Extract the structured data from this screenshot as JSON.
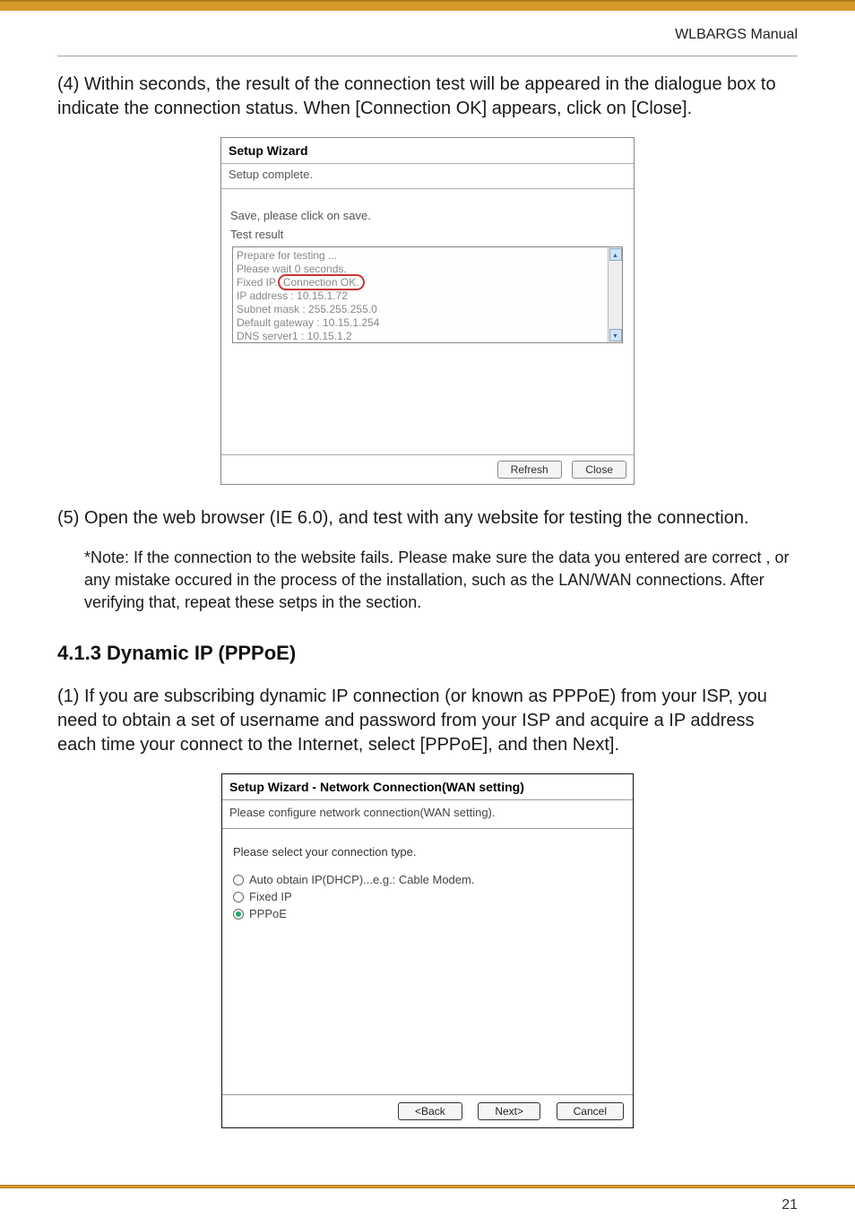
{
  "header": {
    "manual_title": "WLBARGS Manual"
  },
  "step4": {
    "num": "(4)",
    "text": "Within seconds, the result of the connection test will be appeared in the dialogue box to indicate the connection status. When [Connection OK] appears, click on [Close]."
  },
  "shot1": {
    "title": "Setup Wizard",
    "subtitle": "Setup complete.",
    "save_line": "Save, please click on save.",
    "test_label": "Test result",
    "lines": {
      "l1": "Prepare for testing ...",
      "l2a": "Please wait 0 seconds.",
      "l3a": "Fixed IP.",
      "l3b": "Connection OK.",
      "l4": "IP address : 10.15.1.72",
      "l5": "Subnet mask : 255.255.255.0",
      "l6": "Default gateway : 10.15.1.254",
      "l7": "DNS server1 : 10.15.1.2"
    },
    "scroll_up": "▴",
    "scroll_down": "▾",
    "btn_refresh": "Refresh",
    "btn_close": "Close"
  },
  "step5": {
    "num": "(5)",
    "text": "Open the web browser (IE 6.0), and test with any website for testing the connection."
  },
  "note": {
    "label": "*Note:",
    "text": "If the connection to the website fails. Please make sure the data you entered are correct , or any mistake occured in the process of the installation, such as the LAN/WAN connections. After verifying that, repeat these setps in the section."
  },
  "section": {
    "heading": "4.1.3 Dynamic IP (PPPoE)"
  },
  "step1b": {
    "num": "(1)",
    "text": "If you are subscribing dynamic IP connection (or known as PPPoE) from your ISP, you need to obtain a set of username and password from your ISP and acquire a IP address each time your connect to the Internet, select [PPPoE], and then Next]."
  },
  "shot2": {
    "title": "Setup Wizard - Network Connection(WAN setting)",
    "subtitle": "Please configure network connection(WAN setting).",
    "prompt": "Please select your connection type.",
    "opt1": "Auto obtain IP(DHCP)...e.g.: Cable Modem.",
    "opt2": "Fixed IP",
    "opt3": "PPPoE",
    "btn_back": "<Back",
    "btn_next": "Next>",
    "btn_cancel": "Cancel"
  },
  "page_number": "21"
}
